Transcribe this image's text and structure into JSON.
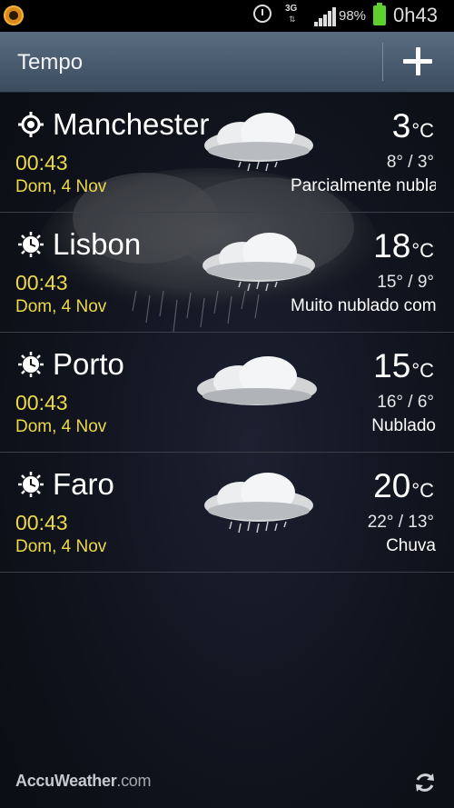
{
  "status_bar": {
    "network": "3G",
    "battery_percent": "98%",
    "time": "0h43",
    "icons": [
      "app-notification-icon",
      "alarm-icon",
      "signal-icon",
      "battery-icon"
    ]
  },
  "header": {
    "title": "Tempo",
    "add_icon": "plus-icon"
  },
  "cities": [
    {
      "name": "Manchester",
      "time": "00:43",
      "date": "Dom, 4 Nov",
      "temp": "3",
      "unit": "°C",
      "minmax": "8° / 3°",
      "condition": "Parcialmente nublado",
      "icon": "location-icon"
    },
    {
      "name": "Lisbon",
      "time": "00:43",
      "date": "Dom, 4 Nov",
      "temp": "18",
      "unit": "°C",
      "minmax": "15° / 9°",
      "condition": "Muito nublado com chuva",
      "icon": "night-clock-icon"
    },
    {
      "name": "Porto",
      "time": "00:43",
      "date": "Dom, 4 Nov",
      "temp": "15",
      "unit": "°C",
      "minmax": "16° / 6°",
      "condition": "Nublado",
      "icon": "night-clock-icon"
    },
    {
      "name": "Faro",
      "time": "00:43",
      "date": "Dom, 4 Nov",
      "temp": "20",
      "unit": "°C",
      "minmax": "22° / 13°",
      "condition": "Chuva",
      "icon": "night-clock-icon"
    }
  ],
  "footer": {
    "brand": "AccuWeather",
    "brand_suffix": ".com",
    "refresh_icon": "refresh-icon"
  },
  "colors": {
    "time_date": "#ecd94a",
    "header_bg": "#4a5c6e",
    "battery": "#5ed12f"
  }
}
